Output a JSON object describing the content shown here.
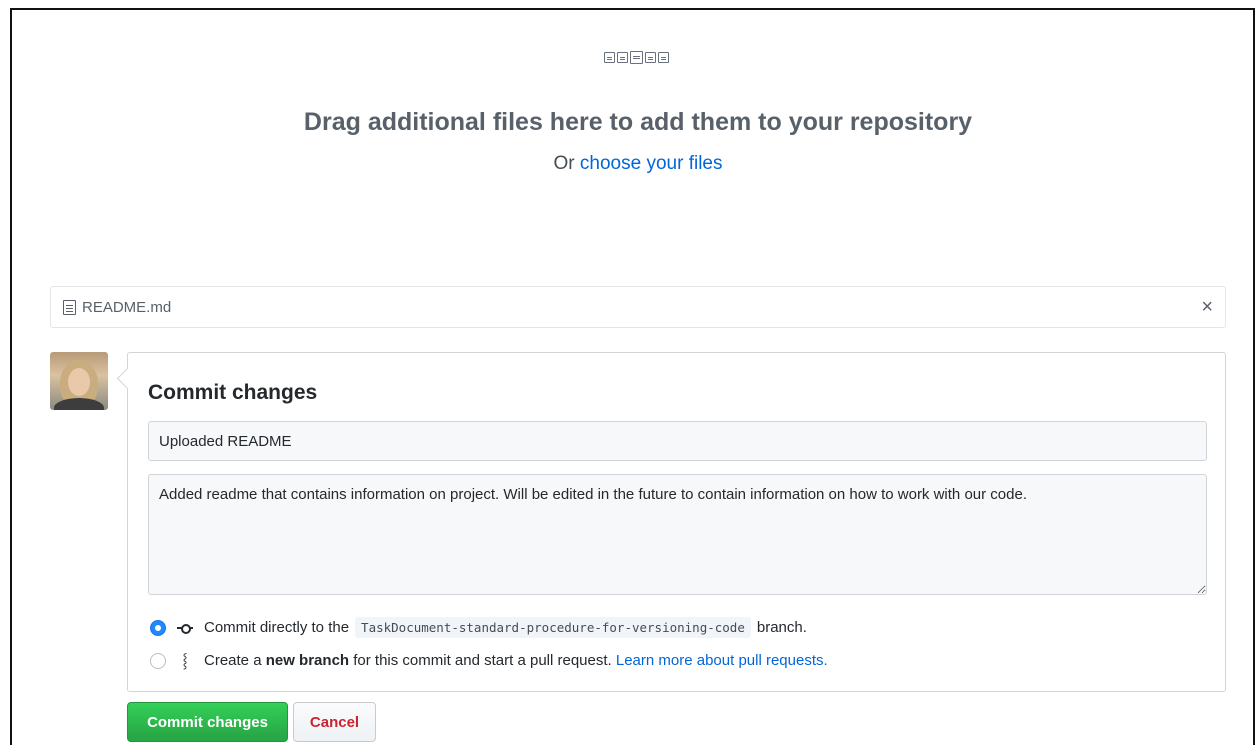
{
  "dropzone": {
    "title": "Drag additional files here to add them to your repository",
    "sub_prefix": "Or",
    "choose_link": "choose your files"
  },
  "file": {
    "name": "README.md",
    "close_icon": "×"
  },
  "commit": {
    "heading": "Commit changes",
    "summary_value": "Uploaded README",
    "description_value": "Added readme that contains information on project. Will be edited in the future to contain information on how to work with our code.",
    "option_direct": {
      "prefix": "Commit directly to the",
      "branch": "TaskDocument-standard-procedure-for-versioning-code",
      "suffix": "branch.",
      "selected": true
    },
    "option_new": {
      "prefix": "Create a",
      "bold": "new branch",
      "suffix": "for this commit and start a pull request.",
      "link": "Learn more about pull requests.",
      "selected": false
    }
  },
  "buttons": {
    "commit_label": "Commit changes",
    "cancel_label": "Cancel"
  },
  "colors": {
    "link": "#0366d6",
    "primary_green": "#28a745",
    "danger_red": "#cb2431",
    "radio_blue": "#2188ff"
  }
}
